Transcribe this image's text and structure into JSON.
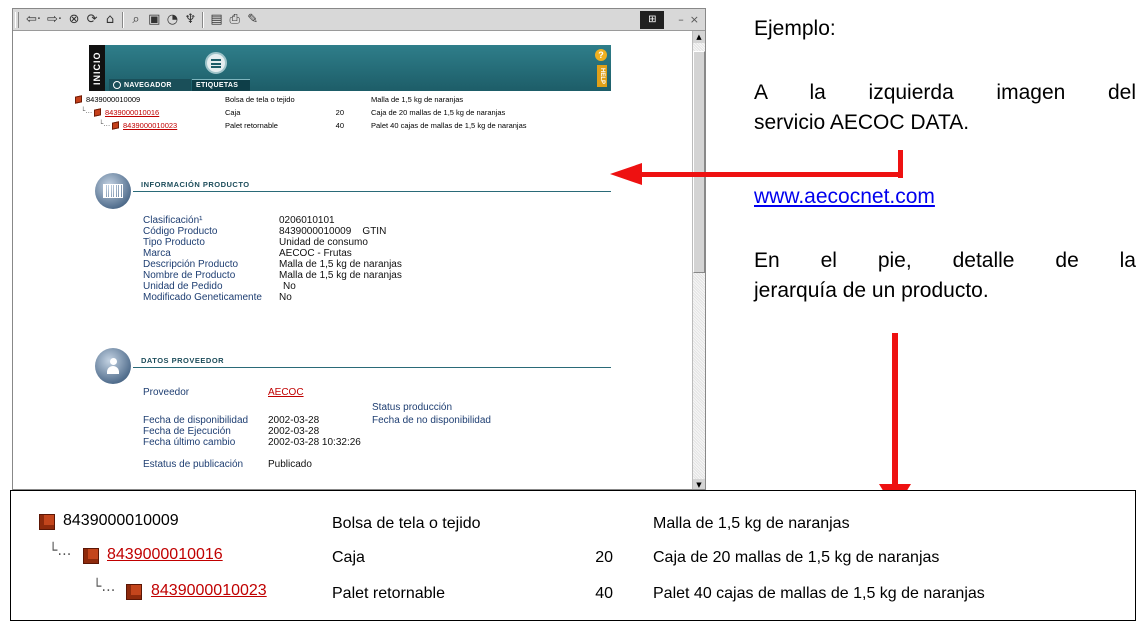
{
  "browser": {
    "toolbar": {
      "icons": [
        "back-arrow-icon",
        "forward-arrow-icon",
        "stop-icon",
        "refresh-icon",
        "home-icon",
        "search-icon",
        "favorites-icon",
        "history-icon",
        "channels-icon",
        "fullscreen-icon",
        "print-icon",
        "edit-icon"
      ],
      "window_controls": [
        "minimize-icon",
        "close-icon"
      ]
    },
    "banner": {
      "side_label": "INICIO",
      "tabs": [
        "NAVEGADOR",
        "ETIQUETAS"
      ],
      "help_label": "HELP",
      "help_symbol": "?",
      "color": "#1d5d68"
    },
    "mini_tree": [
      {
        "code": "8439000010009",
        "desc": "Bolsa de tela o tejido",
        "qty": "",
        "long": "Malla de 1,5 kg de naranjas",
        "link": false
      },
      {
        "code": "8439000010016",
        "desc": "Caja",
        "qty": "20",
        "long": "Caja de 20 mallas de 1,5 kg de naranjas",
        "link": true
      },
      {
        "code": "8439000010023",
        "desc": "Palet retornable",
        "qty": "40",
        "long": "Palet 40 cajas de mallas de 1,5 kg de naranjas",
        "link": true
      }
    ],
    "producto": {
      "title": "INFORMACIÓN PRODUCTO",
      "fields": [
        {
          "label": "Clasificación¹",
          "value": "0206010101"
        },
        {
          "label": "Código Producto",
          "value": "8439000010009    GTIN"
        },
        {
          "label": "Tipo Producto",
          "value": "Unidad de consumo"
        },
        {
          "label": "Marca",
          "value": "AECOC - Frutas"
        },
        {
          "label": "Descripción Producto",
          "value": "Malla de 1,5 kg de naranjas"
        },
        {
          "label": "Nombre de Producto",
          "value": "Malla de 1,5 kg de naranjas"
        },
        {
          "label": "Unidad de Pedido",
          "value": "No"
        },
        {
          "label": "Modificado Geneticamente",
          "value": "No"
        }
      ]
    },
    "proveedor": {
      "title": "DATOS PROVEEDOR",
      "proveedor_label": "Proveedor",
      "proveedor_value": "AECOC",
      "status_label": "Status producción",
      "fecha_no_disp_label": "Fecha de no disponibilidad",
      "fecha_disp_label": "Fecha de disponibilidad",
      "fecha_disp_value": "2002-03-28",
      "fecha_ejec_label": "Fecha de Ejecución",
      "fecha_ejec_value": "2002-03-28",
      "fecha_cambio_label": "Fecha último cambio",
      "fecha_cambio_value": "2002-03-28 10:32:26",
      "estatus_label": "Estatus de publicación",
      "estatus_value": "Publicado"
    }
  },
  "side": {
    "ejemplo": "Ejemplo:",
    "line1": "A la izquierda imagen del",
    "line2": "servicio AECOC DATA.",
    "link": "www.aecocnet.com",
    "line3": "En el pie, detalle de la",
    "line4": "jerarquía de un producto."
  },
  "detail": [
    {
      "code": "8439000010009",
      "desc": "Bolsa de tela o tejido",
      "qty": "",
      "long": "Malla de 1,5 kg de naranjas",
      "link": false
    },
    {
      "code": "8439000010016",
      "desc": "Caja",
      "qty": "20",
      "long": "Caja de 20 mallas de 1,5 kg de naranjas",
      "link": true
    },
    {
      "code": "8439000010023",
      "desc": "Palet retornable",
      "qty": "40",
      "long": "Palet 40 cajas de mallas de 1,5 kg de naranjas",
      "link": true
    }
  ],
  "colors": {
    "arrow": "#ee1111",
    "link": "#c00000",
    "label": "#1e3e72"
  }
}
